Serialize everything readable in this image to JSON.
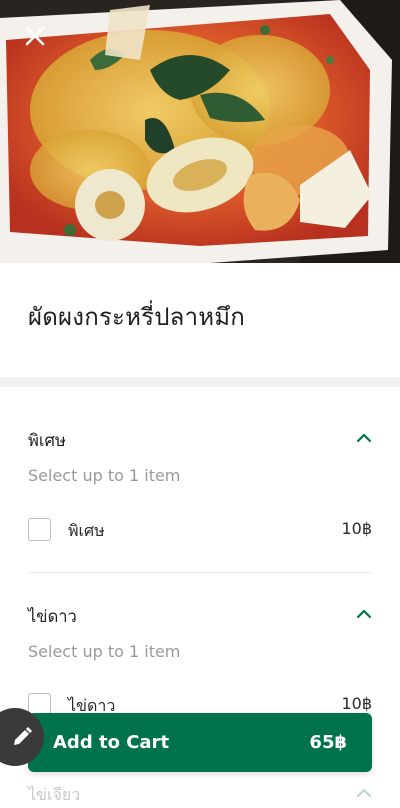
{
  "dish": {
    "title": "ผัดผงกระหรี่ปลาหมึก",
    "image_icon": "food-photo"
  },
  "header": {
    "close_icon": "close-icon"
  },
  "groups": [
    {
      "title": "พิเศษ",
      "hint": "Select up to 1 item",
      "expanded": true,
      "options": [
        {
          "label": "พิเศษ",
          "price": "10฿",
          "checked": false
        }
      ]
    },
    {
      "title": "ไข่ดาว",
      "hint": "Select up to 1 item",
      "expanded": true,
      "options": [
        {
          "label": "ไข่ดาว",
          "price": "10฿",
          "checked": false
        }
      ]
    }
  ],
  "next_group_partial": "ไข่เจียว",
  "cart": {
    "label": "Add to Cart",
    "total": "65฿"
  },
  "colors": {
    "accent": "#00734c",
    "hint": "#9a9a9a",
    "band": "#f2f2f2"
  }
}
